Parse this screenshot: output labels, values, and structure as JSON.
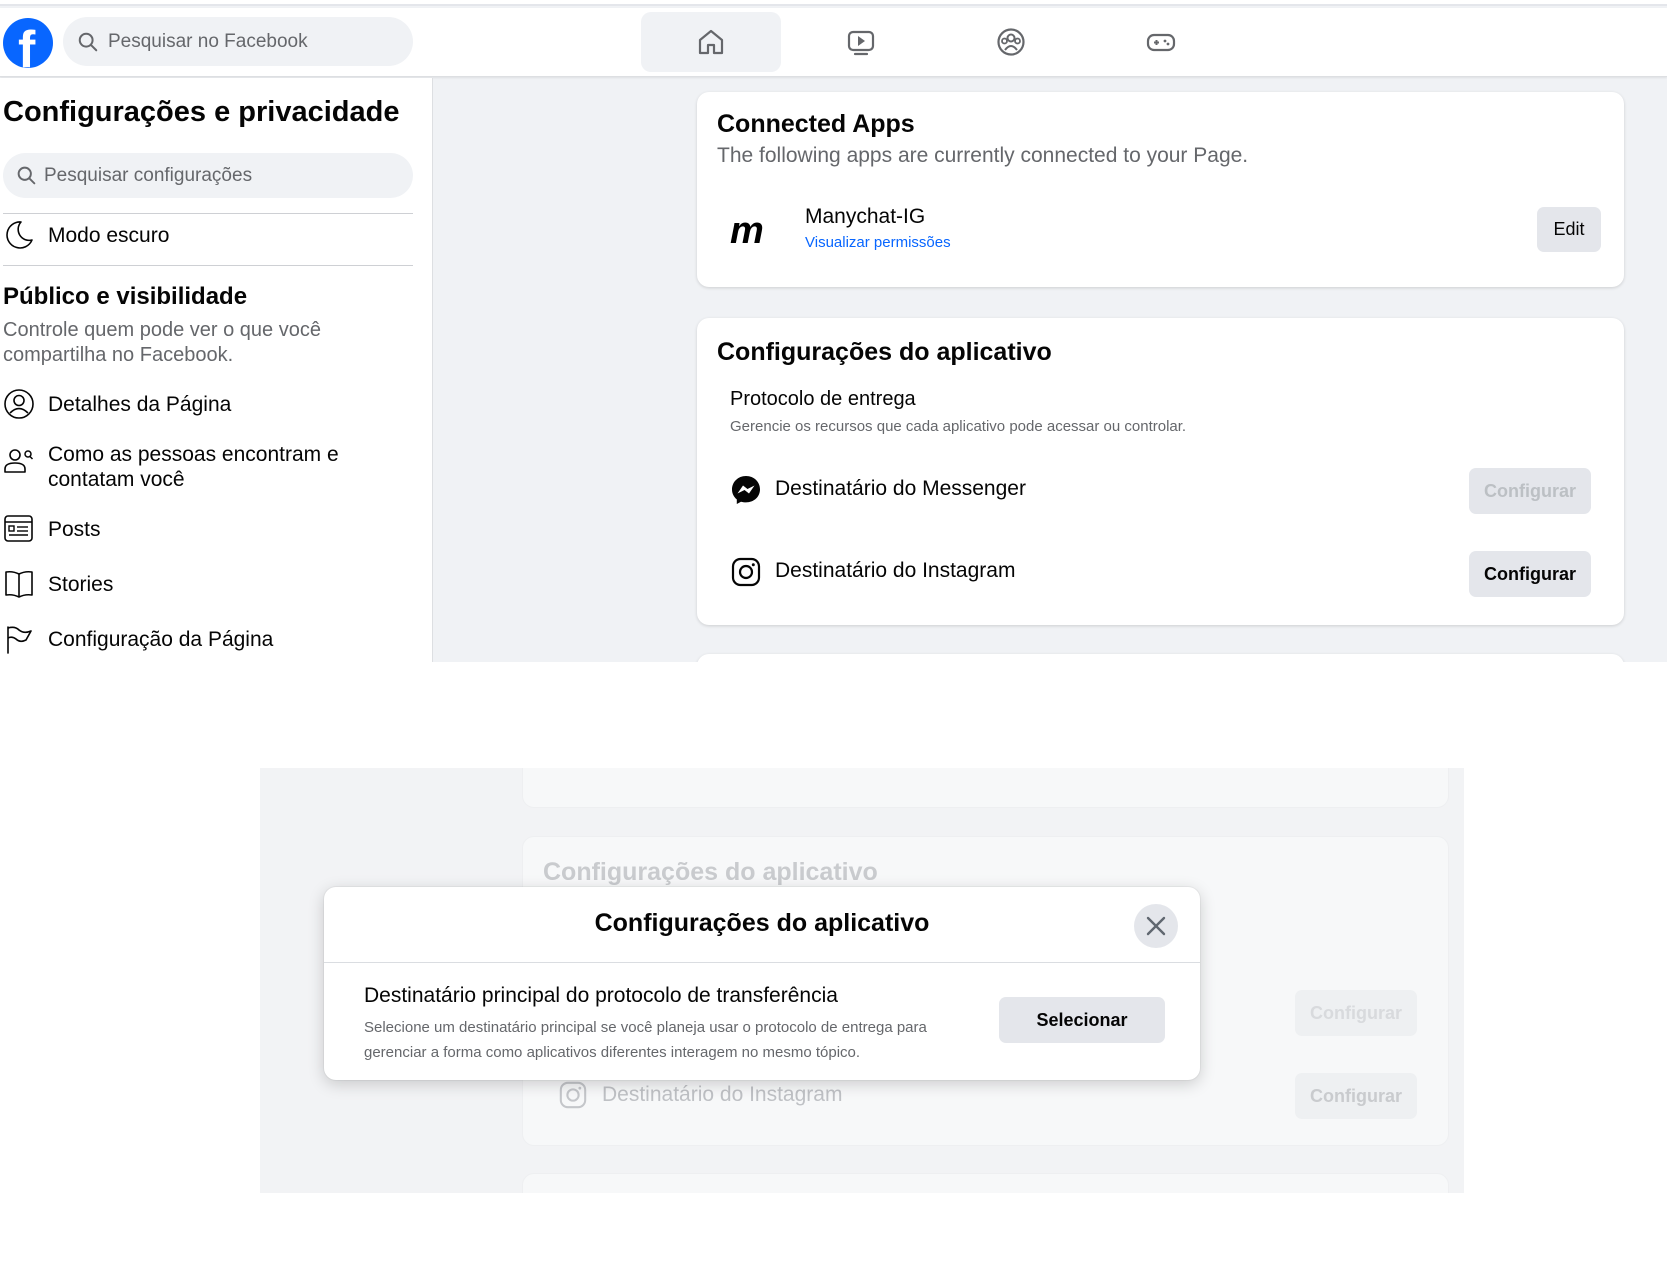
{
  "topbar": {
    "search_placeholder": "Pesquisar no Facebook",
    "tabs": [
      "home-icon",
      "video-icon",
      "groups-icon",
      "gaming-icon"
    ]
  },
  "sidebar": {
    "title": "Configurações e privacidade",
    "search_placeholder": "Pesquisar configurações",
    "dark_mode": "Modo escuro",
    "section_title": "Público e visibilidade",
    "section_desc": "Controle quem pode ver o que você compartilha no Facebook.",
    "items": [
      {
        "label": "Detalhes da Página",
        "icon": "profile-icon"
      },
      {
        "label": "Como as pessoas encontram e contatam você",
        "icon": "people-search-icon"
      },
      {
        "label": "Posts",
        "icon": "posts-icon"
      },
      {
        "label": "Stories",
        "icon": "book-icon"
      },
      {
        "label": "Configuração da Página",
        "icon": "flag-icon"
      }
    ]
  },
  "connected_apps": {
    "title": "Connected Apps",
    "subtitle": "The following apps are currently connected to your Page.",
    "app_name": "Manychat-IG",
    "app_link": "Visualizar permissões",
    "edit_label": "Edit"
  },
  "app_settings": {
    "title": "Configurações do aplicativo",
    "protocol_title": "Protocolo de entrega",
    "protocol_desc": "Gerencie os recursos que cada aplicativo pode acessar ou controlar.",
    "messenger_label": "Destinatário do Messenger",
    "instagram_label": "Destinatário do Instagram",
    "configure_label": "Configurar"
  },
  "modal": {
    "title": "Configurações do aplicativo",
    "heading": "Destinatário principal do protocolo de transferência",
    "description": "Selecione um destinatário principal se você planeja usar o protocolo de entrega para gerenciar a forma como aplicativos diferentes interagem no mesmo tópico.",
    "select_label": "Selecionar"
  },
  "colors": {
    "brand": "#0866ff",
    "background": "#f0f2f5",
    "button_gray": "#e4e6eb"
  }
}
